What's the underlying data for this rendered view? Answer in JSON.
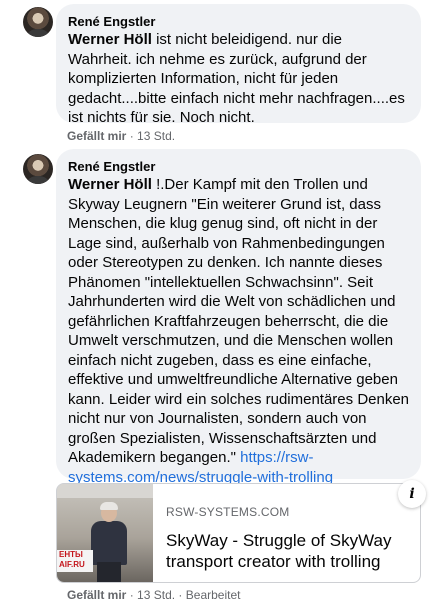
{
  "comments": [
    {
      "author": "René Engstler",
      "mention": "Werner Höll",
      "text": " ist nicht beleidigend. nur die Wahrheit. ich nehme es zurück, aufgrund der komplizierten Information, nicht für jeden gedacht....bitte einfach nicht mehr nachfragen....es ist nichts für sie. Noch nicht.",
      "like_label": "Gefällt mir",
      "time": "13 Std."
    },
    {
      "author": "René Engstler",
      "mention": "Werner Höll",
      "text": " !.Der Kampf mit den Trollen und Skyway Leugnern \"Ein weiterer Grund ist, dass Menschen, die klug genug sind, oft nicht in der Lage sind, außerhalb von Rahmenbedingungen oder Stereotypen zu denken. Ich nannte dieses Phänomen \"intellektuellen Schwachsinn\". Seit Jahrhunderten wird die Welt von schädlichen und gefährlichen Kraftfahrzeugen beherrscht, die die Umwelt verschmutzen, und die Menschen wollen einfach nicht zugeben, dass es eine einfache, effektive und umweltfreundliche Alternative geben kann. Leider wird ein solches rudimentäres Denken nicht nur von Journalisten, sondern auch von großen Spezialisten, Wissenschaftsärzten und Akademikern begangen.\" ",
      "link": "https://rsw-systems.com/news/struggle-with-trolling",
      "like_label": "Gefällt mir",
      "time": "13 Std.",
      "edited": "Bearbeitet"
    }
  ],
  "preview": {
    "domain": "RSW-SYSTEMS.COM",
    "title": "SkyWay - Struggle of SkyWay transport creator with trolling",
    "thumb_text_1": "ЕНТЫ",
    "thumb_text_2": "AIF.RU",
    "info_icon": "i"
  },
  "separator": "·"
}
